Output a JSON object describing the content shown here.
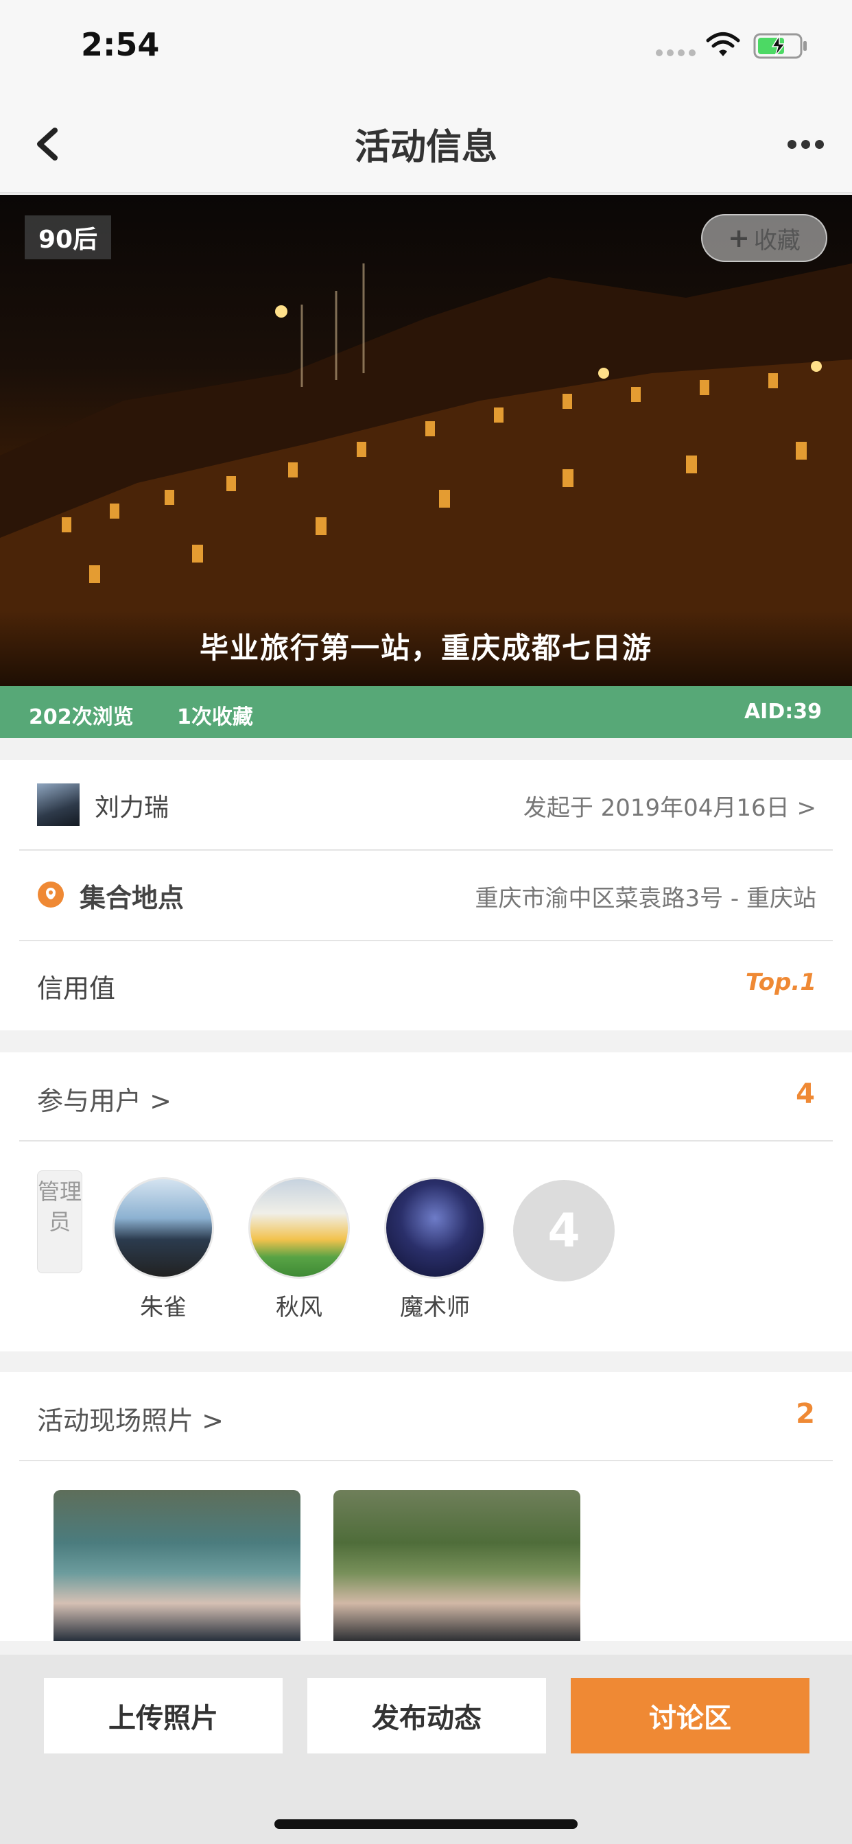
{
  "status_bar": {
    "time": "2:54"
  },
  "nav": {
    "title": "活动信息"
  },
  "hero": {
    "tag": "90后",
    "favorite_label": "收藏",
    "favorite_plus": "+",
    "caption": "毕业旅行第一站，重庆成都七日游"
  },
  "stats": {
    "views": "202次浏览",
    "favorites": "1次收藏",
    "aid": "AID:39"
  },
  "info": {
    "owner_name": "刘力瑞",
    "launch_text": "发起于 2019年04月16日 >",
    "location_label": "集合地点",
    "location_value": "重庆市渝中区菜袁路3号 - 重庆站",
    "credit_label": "信用值",
    "credit_value": "Top.1"
  },
  "participants": {
    "title": "参与用户 >",
    "count": "4",
    "admin_tag": "管理员",
    "members": [
      {
        "name": "朱雀"
      },
      {
        "name": "秋风"
      },
      {
        "name": "魔术师"
      }
    ],
    "more_count": "4"
  },
  "photos": {
    "title": "活动现场照片 >",
    "count": "2"
  },
  "bottom": {
    "upload": "上传照片",
    "post": "发布动态",
    "discuss": "讨论区"
  },
  "colors": {
    "accent": "#ef8934",
    "stats_green": "#57a877"
  }
}
